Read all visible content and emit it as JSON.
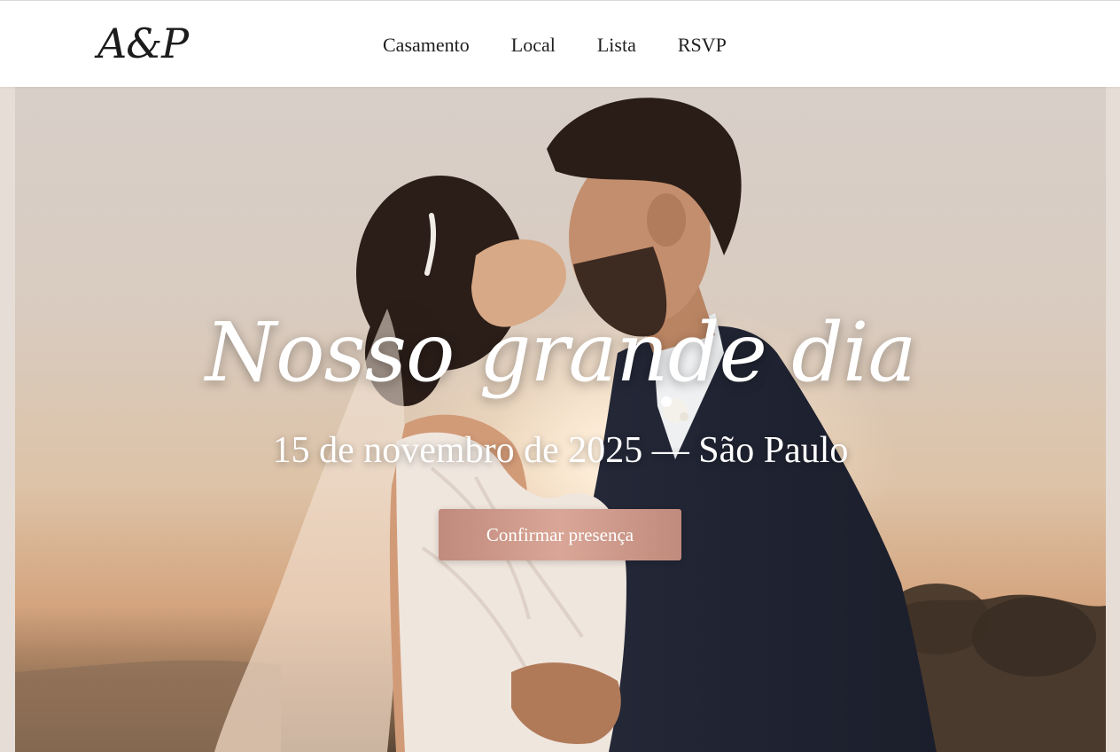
{
  "header": {
    "logo": "A&P",
    "nav": [
      "Casamento",
      "Local",
      "Lista",
      "RSVP"
    ]
  },
  "hero": {
    "title": "Nosso grande dia",
    "subtitle": "15 de novembro de 2025 — São Paulo",
    "cta_label": "Confirmar presença"
  },
  "colors": {
    "cta": "#d0998a",
    "header_bg": "#ffffff",
    "page_bg": "#e6ddd6"
  }
}
